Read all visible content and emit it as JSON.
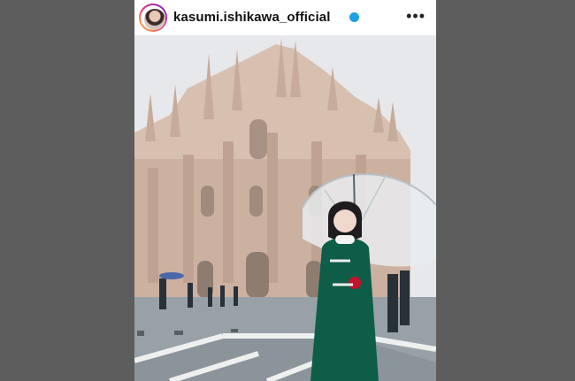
{
  "post": {
    "username": "kasumi.ishikawa_official",
    "verified": true,
    "more_label": "•••"
  },
  "icons": {
    "verified": "verified-badge-icon",
    "more": "more-options-icon"
  },
  "colors": {
    "sky": "#e6e7ea",
    "cathedral": "#d9c1b2",
    "coat": "#0f5b47",
    "plaza": "#9aa3a8",
    "verified": "#20a0e0",
    "background": "#5d5d5d"
  }
}
